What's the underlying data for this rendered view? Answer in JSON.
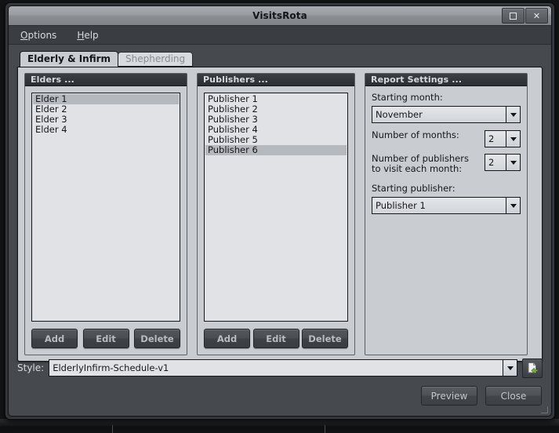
{
  "window": {
    "title": "VisitsRota",
    "controls": [
      {
        "name": "maximize",
        "glyph": ""
      },
      {
        "name": "close",
        "glyph": "✕"
      }
    ]
  },
  "menubar": {
    "items": [
      {
        "mnemonic": "O",
        "rest": "ptions"
      },
      {
        "mnemonic": "H",
        "rest": "elp"
      }
    ]
  },
  "tabs": [
    {
      "label": "Elderly & Infirm",
      "active": true
    },
    {
      "label": "Shepherding",
      "active": false
    }
  ],
  "elders_panel": {
    "header": "Elders ...",
    "items": [
      {
        "label": "Elder 1",
        "selected": true
      },
      {
        "label": "Elder 2",
        "selected": false
      },
      {
        "label": "Elder 3",
        "selected": false
      },
      {
        "label": "Elder 4",
        "selected": false
      }
    ],
    "buttons": [
      "Add",
      "Edit",
      "Delete"
    ]
  },
  "publishers_panel": {
    "header": "Publishers ...",
    "items": [
      {
        "label": "Publisher 1",
        "selected": false
      },
      {
        "label": "Publisher 2",
        "selected": false
      },
      {
        "label": "Publisher 3",
        "selected": false
      },
      {
        "label": "Publisher 4",
        "selected": false
      },
      {
        "label": "Publisher 5",
        "selected": false
      },
      {
        "label": "Publisher 6",
        "selected": true
      }
    ],
    "buttons": [
      "Add",
      "Edit",
      "Delete"
    ]
  },
  "report_panel": {
    "header": "Report Settings ...",
    "starting_month_label": "Starting month:",
    "starting_month_value": "November",
    "number_of_months_label": "Number of months:",
    "number_of_months_value": "2",
    "publishers_per_month_label": "Number of publishers to visit each month:",
    "publishers_per_month_value": "2",
    "starting_publisher_label": "Starting publisher:",
    "starting_publisher_value": "Publisher 1"
  },
  "style_row": {
    "label": "Style:",
    "value": "ElderlyInfirm-Schedule-v1",
    "icon": "document-import-icon"
  },
  "footer": {
    "preview_label": "Preview",
    "close_label": "Close"
  },
  "colors": {
    "panel_bg": "#c9ccd0",
    "window_bg": "#46494e",
    "header_dark": "#2b2e32",
    "list_bg": "#e0e2e5",
    "selection": "#b5b8bc",
    "accent_green": "#7cbb2e"
  }
}
